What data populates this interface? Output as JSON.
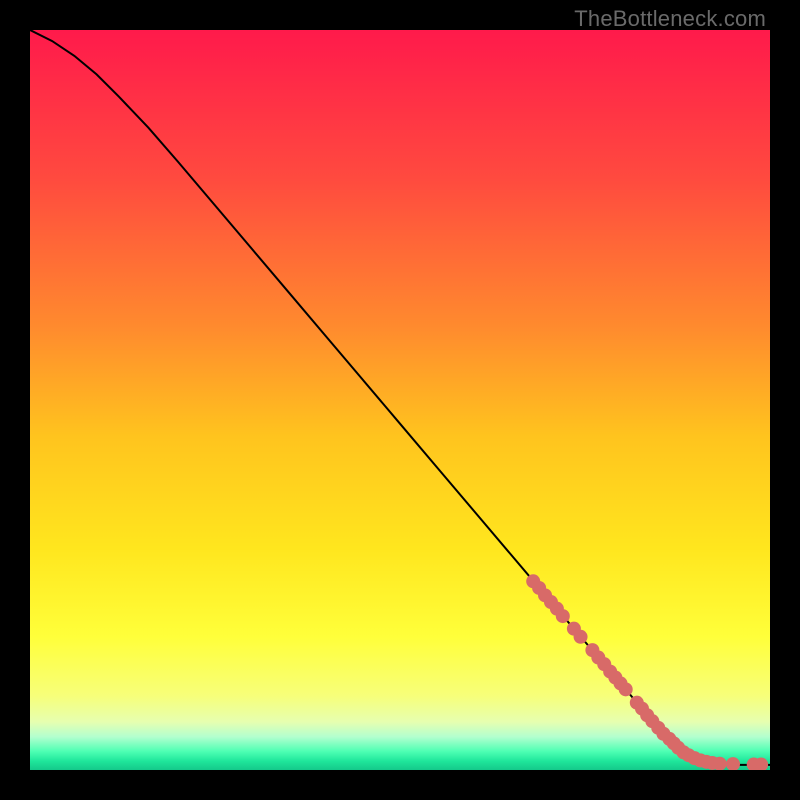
{
  "watermark": "TheBottleneck.com",
  "chart_data": {
    "type": "line",
    "title": "",
    "xlabel": "",
    "ylabel": "",
    "xlim": [
      0,
      100
    ],
    "ylim": [
      0,
      100
    ],
    "grid": false,
    "legend": false,
    "background_gradient": {
      "stops": [
        {
          "pos": 0.0,
          "color": "#ff1a4b"
        },
        {
          "pos": 0.2,
          "color": "#ff4a3f"
        },
        {
          "pos": 0.4,
          "color": "#ff8a2e"
        },
        {
          "pos": 0.55,
          "color": "#ffc41e"
        },
        {
          "pos": 0.7,
          "color": "#ffe61e"
        },
        {
          "pos": 0.82,
          "color": "#ffff3a"
        },
        {
          "pos": 0.9,
          "color": "#f7ff7a"
        },
        {
          "pos": 0.935,
          "color": "#e6ffb0"
        },
        {
          "pos": 0.955,
          "color": "#b3ffcf"
        },
        {
          "pos": 0.975,
          "color": "#4dffb3"
        },
        {
          "pos": 0.988,
          "color": "#1fe69b"
        },
        {
          "pos": 1.0,
          "color": "#14c98a"
        }
      ]
    },
    "series": [
      {
        "name": "curve",
        "stroke": "#000000",
        "x": [
          0,
          3,
          6,
          9,
          12,
          16,
          20,
          25,
          30,
          35,
          40,
          45,
          50,
          55,
          60,
          65,
          70,
          74,
          77,
          79,
          81,
          82.5,
          84,
          86,
          88,
          90,
          92,
          94,
          96,
          98,
          100
        ],
        "y": [
          100,
          98.5,
          96.5,
          94,
          91,
          86.8,
          82.2,
          76.3,
          70.4,
          64.5,
          58.6,
          52.7,
          46.8,
          40.9,
          35.0,
          29.1,
          23.2,
          18.5,
          15.0,
          12.6,
          10.3,
          8.5,
          6.8,
          4.7,
          3.0,
          1.8,
          1.1,
          0.8,
          0.7,
          0.7,
          0.7
        ]
      }
    ],
    "markers": {
      "color": "#d86a68",
      "radius_px": 7,
      "points": [
        {
          "x": 68.0,
          "y": 25.5
        },
        {
          "x": 68.8,
          "y": 24.6
        },
        {
          "x": 69.6,
          "y": 23.6
        },
        {
          "x": 70.4,
          "y": 22.7
        },
        {
          "x": 71.2,
          "y": 21.8
        },
        {
          "x": 72.0,
          "y": 20.8
        },
        {
          "x": 73.5,
          "y": 19.1
        },
        {
          "x": 74.4,
          "y": 18.0
        },
        {
          "x": 76.0,
          "y": 16.2
        },
        {
          "x": 76.8,
          "y": 15.2
        },
        {
          "x": 77.6,
          "y": 14.3
        },
        {
          "x": 78.4,
          "y": 13.3
        },
        {
          "x": 79.1,
          "y": 12.5
        },
        {
          "x": 79.8,
          "y": 11.7
        },
        {
          "x": 80.5,
          "y": 10.9
        },
        {
          "x": 82.0,
          "y": 9.1
        },
        {
          "x": 82.7,
          "y": 8.3
        },
        {
          "x": 83.4,
          "y": 7.4
        },
        {
          "x": 84.1,
          "y": 6.6
        },
        {
          "x": 84.9,
          "y": 5.7
        },
        {
          "x": 85.6,
          "y": 4.9
        },
        {
          "x": 86.4,
          "y": 4.2
        },
        {
          "x": 87.0,
          "y": 3.6
        },
        {
          "x": 87.6,
          "y": 3.0
        },
        {
          "x": 88.3,
          "y": 2.4
        },
        {
          "x": 89.0,
          "y": 2.0
        },
        {
          "x": 89.8,
          "y": 1.6
        },
        {
          "x": 90.6,
          "y": 1.3
        },
        {
          "x": 91.4,
          "y": 1.1
        },
        {
          "x": 92.2,
          "y": 0.95
        },
        {
          "x": 93.2,
          "y": 0.85
        },
        {
          "x": 95.0,
          "y": 0.8
        },
        {
          "x": 97.8,
          "y": 0.75
        },
        {
          "x": 98.8,
          "y": 0.75
        }
      ]
    }
  }
}
